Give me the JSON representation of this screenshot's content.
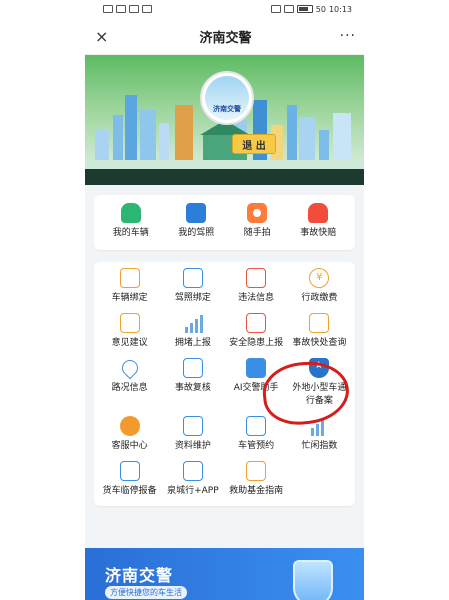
{
  "status_bar": {
    "left_icons": [
      "sim-icon",
      "signal-icon",
      "wifi-icon",
      "notification-icon"
    ],
    "right_icons": [
      "alarm-icon",
      "vibrate-icon",
      "battery-icon"
    ],
    "battery_percent": "50",
    "time": "10:13"
  },
  "header": {
    "close_icon": "×",
    "title": "济南交警",
    "more_icon": "···"
  },
  "banner": {
    "avatar_text": "济南交警",
    "logout_label": "退 出"
  },
  "quick_actions": [
    {
      "label": "我的车辆",
      "icon": "car-icon"
    },
    {
      "label": "我的驾照",
      "icon": "license-icon"
    },
    {
      "label": "随手拍",
      "icon": "camera-icon"
    },
    {
      "label": "事故快赔",
      "icon": "accident-icon"
    }
  ],
  "services": [
    {
      "label": "车辆绑定",
      "icon": "car-bind-icon"
    },
    {
      "label": "驾照绑定",
      "icon": "license-bind-icon"
    },
    {
      "label": "违法信息",
      "icon": "violation-icon"
    },
    {
      "label": "行政缴费",
      "icon": "payment-icon"
    },
    {
      "label": "意见建议",
      "icon": "suggestion-icon"
    },
    {
      "label": "拥堵上报",
      "icon": "congestion-icon"
    },
    {
      "label": "安全隐患上报",
      "icon": "hazard-icon"
    },
    {
      "label": "事故快处查询",
      "icon": "accident-query-icon"
    },
    {
      "label": "路况信息",
      "icon": "location-pin-icon"
    },
    {
      "label": "事故复核",
      "icon": "review-icon"
    },
    {
      "label": "AI交警助手",
      "icon": "ai-assistant-icon"
    },
    {
      "label": "外地小型车通行备案",
      "icon": "shield-star-icon"
    },
    {
      "label": "客服中心",
      "icon": "headset-icon"
    },
    {
      "label": "资料维护",
      "icon": "document-icon"
    },
    {
      "label": "车管预约",
      "icon": "calendar-icon"
    },
    {
      "label": "忙闲指数",
      "icon": "chart-bars-icon"
    },
    {
      "label": "货车临停报备",
      "icon": "truck-icon"
    },
    {
      "label": "泉城行+APP",
      "icon": "app-icon"
    },
    {
      "label": "救助基金指南",
      "icon": "fund-icon"
    }
  ],
  "bottom_banner": {
    "title": "济南交警",
    "subtitle": "方便快捷您的车生活"
  },
  "colors": {
    "accent_blue": "#2b73c9",
    "annotation_red": "#d81b1b",
    "banner_green": "#5cbb62",
    "logout_yellow": "#f7c947"
  }
}
